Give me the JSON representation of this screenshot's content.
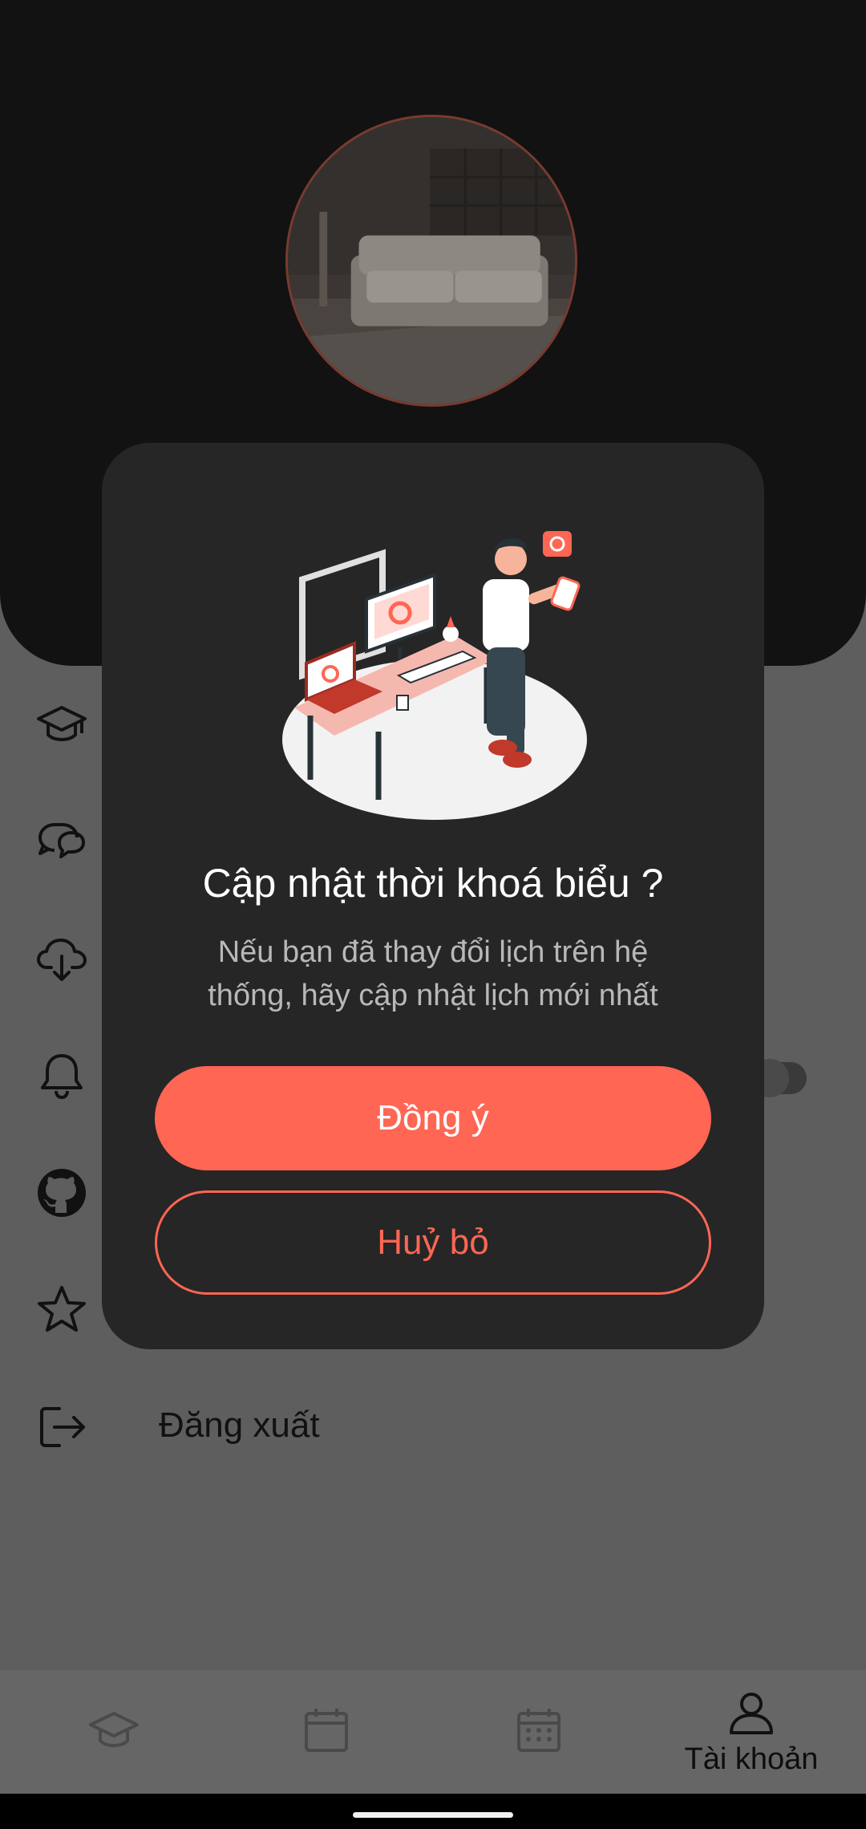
{
  "colors": {
    "accent": "#ff6654",
    "dialog_bg": "#262626",
    "header_bg": "#121212",
    "scrim": "#5e5e5e"
  },
  "header": {
    "avatar_icon": "profile-photo-living-room"
  },
  "menu": {
    "items": [
      {
        "icon": "graduation-cap-icon",
        "label": ""
      },
      {
        "icon": "chat-bubbles-icon",
        "label": ""
      },
      {
        "icon": "cloud-download-icon",
        "label": ""
      },
      {
        "icon": "bell-icon",
        "label": "",
        "toggle": false
      },
      {
        "icon": "github-icon",
        "label": ""
      },
      {
        "icon": "star-icon",
        "label": ""
      },
      {
        "icon": "logout-icon",
        "label": "Đăng xuất"
      }
    ]
  },
  "dialog": {
    "title": "Cập nhật thời khoá biểu ?",
    "message_line1": "Nếu bạn đã thay đổi lịch trên hệ",
    "message_line2": "thống, hãy cập nhật lịch mới nhất",
    "confirm_label": "Đồng ý",
    "cancel_label": "Huỷ bỏ"
  },
  "bottom_nav": {
    "items": [
      {
        "icon": "graduation-cap-icon",
        "label": ""
      },
      {
        "icon": "calendar-icon",
        "label": ""
      },
      {
        "icon": "calendar-grid-icon",
        "label": ""
      },
      {
        "icon": "user-icon",
        "label": "Tài khoản",
        "active": true
      }
    ]
  }
}
